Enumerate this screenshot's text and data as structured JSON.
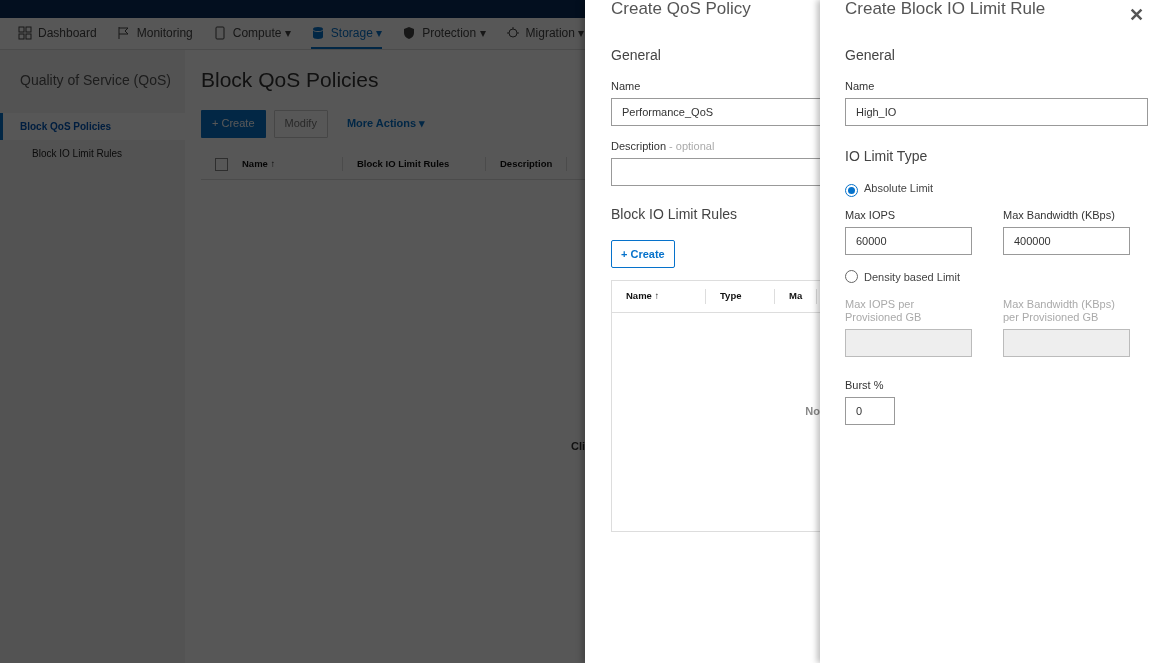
{
  "nav": [
    {
      "label": "Dashboard",
      "selected": false
    },
    {
      "label": "Monitoring",
      "selected": false
    },
    {
      "label": "Compute",
      "caret": "▾",
      "selected": false
    },
    {
      "label": "Storage",
      "caret": "▾",
      "selected": true
    },
    {
      "label": "Protection",
      "caret": "▾",
      "selected": false
    },
    {
      "label": "Migration",
      "caret": "▾",
      "selected": false
    }
  ],
  "sidebar": {
    "title": "Quality of Service (QoS)",
    "items": [
      {
        "label": "Block QoS Policies",
        "selected": true
      },
      {
        "label": "Block IO Limit Rules",
        "selected": false
      }
    ]
  },
  "main": {
    "title": "Block QoS Policies",
    "buttons": [
      {
        "label": "+ Create",
        "kind": "primary",
        "disabled": false
      },
      {
        "label": "Modify",
        "kind": "secondary",
        "disabled": true
      },
      {
        "label": "More Actions ▾",
        "kind": "link",
        "disabled": false
      }
    ],
    "table": {
      "select_all_checked": false,
      "columns": [
        "Name ↑",
        "Block IO Limit Rules",
        "Description"
      ],
      "empty_text": "Cli"
    }
  },
  "policy_panel": {
    "title": "Create QoS Policy",
    "section": "General",
    "name_label": "Name",
    "name_value": "Performance_QoS",
    "description_label": "Description",
    "description_hint": "- optional",
    "rules_title": "Block IO Limit Rules",
    "create_button": "+ Create",
    "table": {
      "columns": [
        "Name ↑",
        "Type",
        "Ma"
      ],
      "empty_text": "No"
    }
  },
  "rule_panel": {
    "title": "Create Block IO Limit Rule",
    "close": "✕",
    "section": "General",
    "name_label": "Name",
    "name_value": "High_IO",
    "type_title": "IO Limit Type",
    "options": [
      {
        "label": "Absolute Limit",
        "selected": true,
        "fields": [
          {
            "label": "Max IOPS",
            "value": "60000"
          },
          {
            "label": "Max Bandwidth (KBps)",
            "value": "400000"
          }
        ]
      },
      {
        "label": "Density based Limit",
        "selected": false,
        "fields": [
          {
            "label": "Max IOPS per Provisioned GB"
          },
          {
            "label": "Max Bandwidth (KBps) per Provisioned GB"
          }
        ]
      }
    ],
    "burst_label": "Burst %",
    "burst_value": "0"
  }
}
